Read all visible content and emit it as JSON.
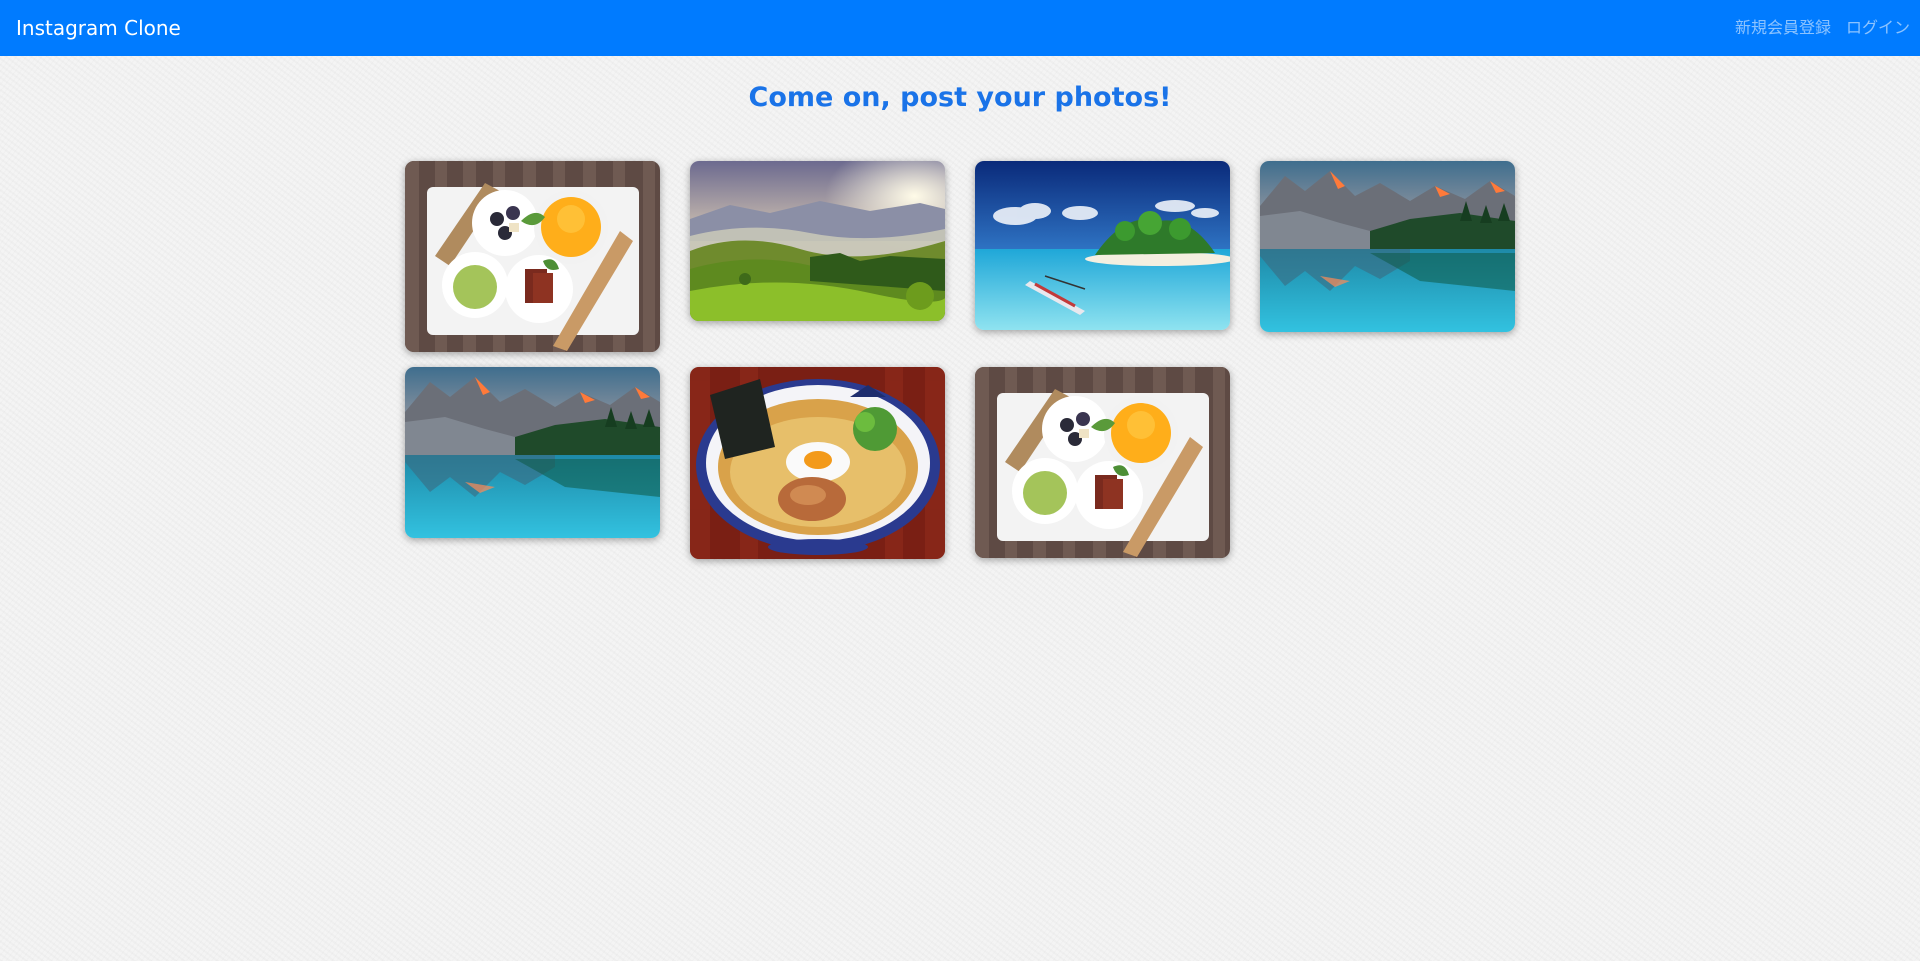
{
  "navbar": {
    "brand": "Instagram Clone",
    "links": [
      "新規会員登録",
      "ログイン"
    ],
    "background": "#007bff"
  },
  "main": {
    "headline": "Come on, post your photos!",
    "headline_color": "#1a73e8"
  },
  "gallery": {
    "photos": [
      {
        "subject": "breakfast plate on wooden table"
      },
      {
        "subject": "green hills landscape at sunrise"
      },
      {
        "subject": "tropical island with boat"
      },
      {
        "subject": "mountain lake reflection"
      },
      {
        "subject": "mountain lake reflection"
      },
      {
        "subject": "ramen bowl"
      },
      {
        "subject": "breakfast plate on wooden table"
      }
    ]
  }
}
